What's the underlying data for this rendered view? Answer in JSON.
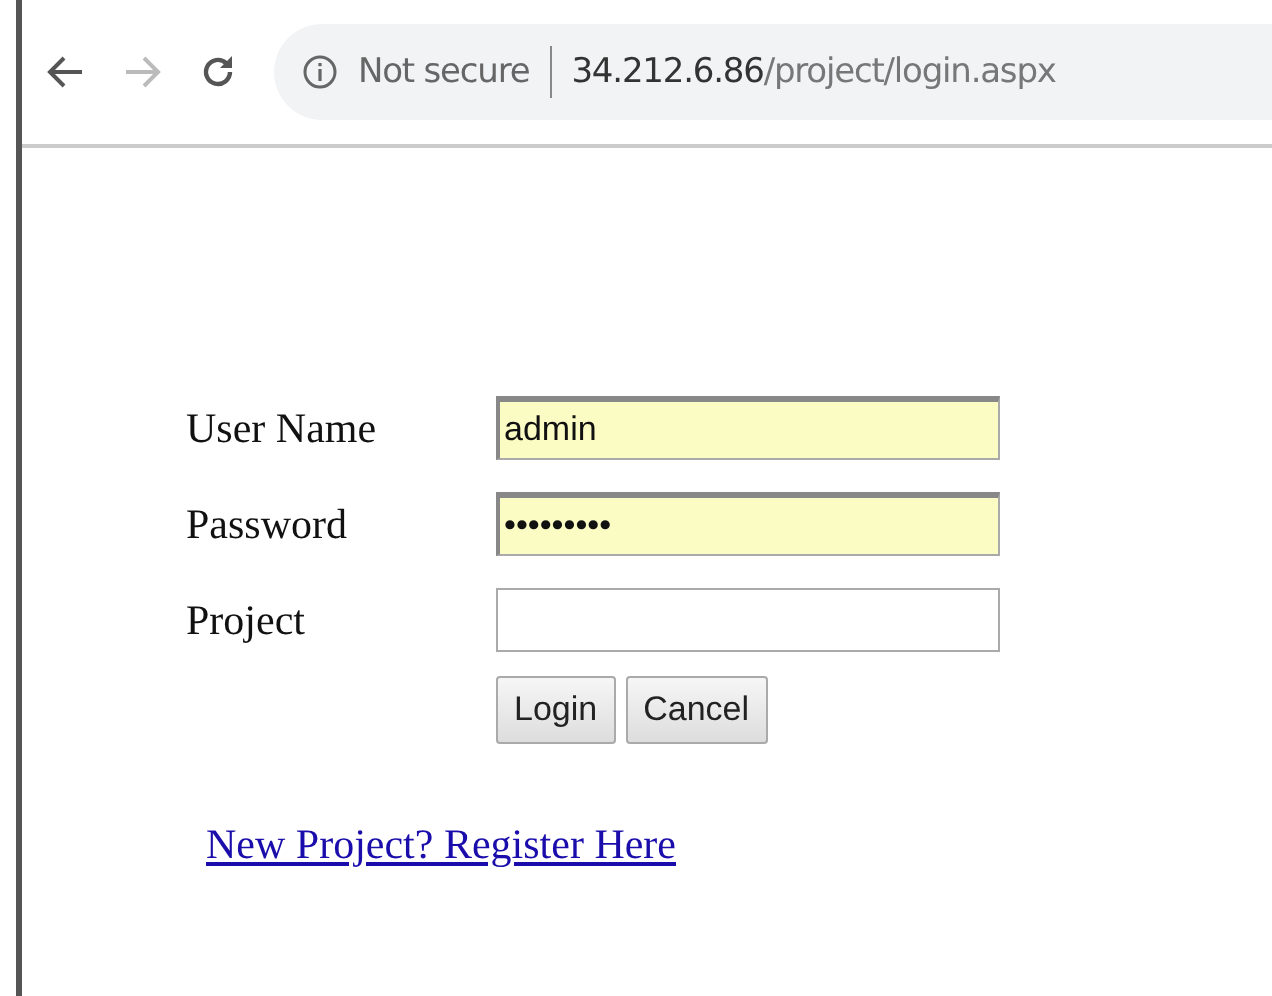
{
  "browser": {
    "back_disabled": false,
    "forward_disabled": true,
    "security": "Not secure",
    "url_host": "34.212.6.86",
    "url_path": "/project/login.aspx"
  },
  "form": {
    "fields": [
      {
        "label": "User Name",
        "value": "admin",
        "autofilled": true
      },
      {
        "label": "Password",
        "value": "•••••••••",
        "autofilled": true
      },
      {
        "label": "Project",
        "autofilled": false
      }
    ],
    "buttons": [
      "Login",
      "Cancel"
    ],
    "link": "New Project? Register Here"
  }
}
